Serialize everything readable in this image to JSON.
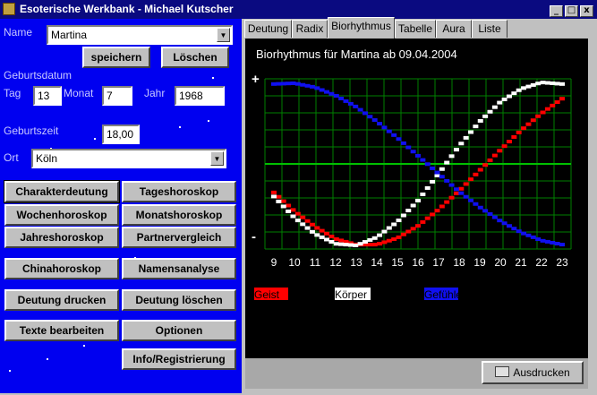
{
  "window": {
    "title": "Esoterische Werkbank - Michael Kutscher",
    "min_label": "_",
    "max_label": "□",
    "close_label": "x"
  },
  "form": {
    "name_label": "Name",
    "name_value": "Martina",
    "save_label": "speichern",
    "delete_label": "Löschen",
    "birthdate_label": "Geburtsdatum",
    "day_label": "Tag",
    "day_value": "13",
    "month_label": "Monat",
    "month_value": "7",
    "year_label": "Jahr",
    "year_value": "1968",
    "birthtime_label": "Geburtszeit",
    "birthtime_value": "18,00",
    "place_label": "Ort",
    "place_value": "Köln"
  },
  "buttons": {
    "charakterdeutung": "Charakterdeutung",
    "tageshoroskop": "Tageshoroskop",
    "wochenhoroskop": "Wochenhoroskop",
    "monatshoroskop": "Monatshoroskop",
    "jahreshoroskop": "Jahreshoroskop",
    "partnervergleich": "Partnervergleich",
    "chinahoroskop": "Chinahoroskop",
    "namensanalyse": "Namensanalyse",
    "deutung_drucken": "Deutung drucken",
    "deutung_loeschen": "Deutung löschen",
    "texte_bearbeiten": "Texte bearbeiten",
    "optionen": "Optionen",
    "info": "Info/Registrierung"
  },
  "tabs": [
    {
      "label": "Deutung"
    },
    {
      "label": "Radix"
    },
    {
      "label": "Biorhythmus"
    },
    {
      "label": "Tabelle"
    },
    {
      "label": "Aura"
    },
    {
      "label": "Liste"
    }
  ],
  "print_label": "Ausdrucken",
  "colors": {
    "geist": "#ff0000",
    "koerper": "#ffffff",
    "gefuehle": "#1010f0",
    "grid": "#008000",
    "zero_line": "#00c000"
  },
  "chart_data": {
    "type": "line",
    "title": "Biorhythmus für Martina ab 09.04.2004",
    "x": [
      9,
      10,
      11,
      12,
      13,
      14,
      15,
      16,
      17,
      18,
      19,
      20,
      21,
      22,
      23
    ],
    "ylim": [
      -1,
      1
    ],
    "y_plus_label": "+",
    "y_minus_label": "-",
    "series": [
      {
        "name": "Geist",
        "values": [
          -0.35,
          -0.58,
          -0.77,
          -0.92,
          -0.99,
          -0.99,
          -0.91,
          -0.76,
          -0.56,
          -0.33,
          -0.08,
          0.17,
          0.41,
          0.62,
          0.8
        ]
      },
      {
        "name": "Körper",
        "values": [
          -0.4,
          -0.66,
          -0.86,
          -0.98,
          -1.0,
          -0.9,
          -0.71,
          -0.45,
          -0.12,
          0.22,
          0.52,
          0.76,
          0.92,
          1.0,
          0.98
        ]
      },
      {
        "name": "Gefühle",
        "values": [
          0.98,
          0.99,
          0.94,
          0.84,
          0.7,
          0.52,
          0.32,
          0.1,
          -0.12,
          -0.34,
          -0.53,
          -0.7,
          -0.84,
          -0.94,
          -0.99
        ]
      }
    ]
  }
}
